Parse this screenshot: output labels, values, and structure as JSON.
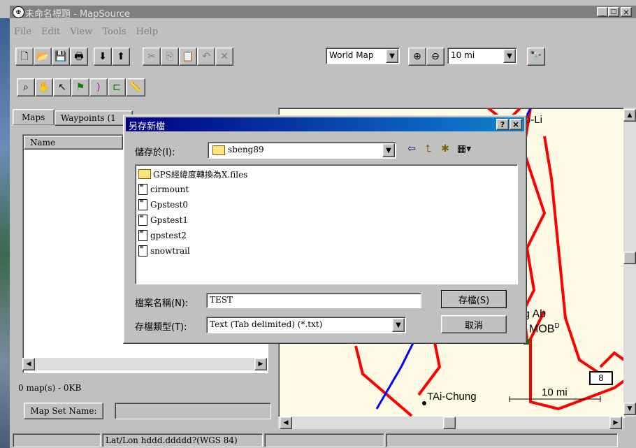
{
  "window": {
    "title": "未命名標題 - MapSource"
  },
  "menu": [
    "File",
    "Edit",
    "View",
    "Tools",
    "Help"
  ],
  "toolbar": {
    "map_product": "World Map",
    "zoom_scale": "10 mi"
  },
  "left_panel": {
    "tabs": [
      "Maps",
      "Waypoints (1"
    ],
    "column_name": "Name",
    "summary": "0 map(s) - 0KB",
    "map_set_button": "Map Set Name:",
    "map_set_value": ""
  },
  "status_bar": {
    "coord_format": "Lat/Lon hddd.ddddd?(WGS 84)"
  },
  "map": {
    "labels": {
      "top_city": "o-Li",
      "airbase": "g Ab",
      "airbase2": "MOB",
      "airbase2_sup": "D",
      "city": "TAi-Chung",
      "scale_label": "10 mi",
      "road_shield": "8"
    },
    "colors": {
      "background": "#fffbe6",
      "road": "#ff0000",
      "river": "#0000ff"
    }
  },
  "dialog": {
    "title": "另存新檔",
    "help_btn": "?",
    "close_btn": "×",
    "save_in_label": "儲存於(I):",
    "save_in_value": "sbeng89",
    "files": [
      {
        "name": "GPS經緯度轉換為X.files",
        "type": "folder"
      },
      {
        "name": "cirmount",
        "type": "file"
      },
      {
        "name": "Gpstest0",
        "type": "file"
      },
      {
        "name": "Gpstest1",
        "type": "file"
      },
      {
        "name": "gpstest2",
        "type": "file"
      },
      {
        "name": "snowtrail",
        "type": "file"
      }
    ],
    "filename_label": "檔案名稱(N):",
    "filename_value": "TEST",
    "filetype_label": "存檔類型(T):",
    "filetype_value": "Text (Tab delimited) (*.txt)",
    "save_button": "存檔(S)",
    "cancel_button": "取消"
  }
}
